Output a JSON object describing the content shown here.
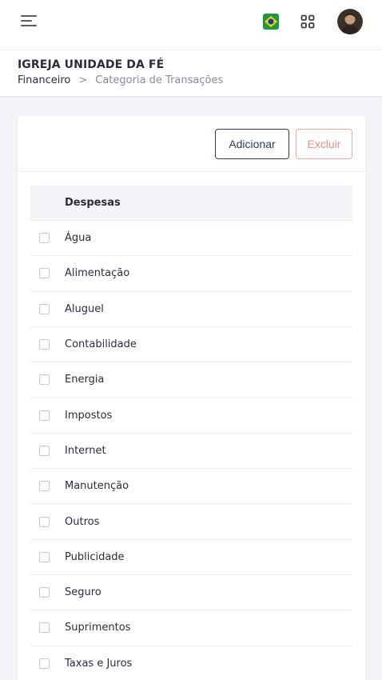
{
  "header": {
    "menu_icon": "hamburger-menu-icon",
    "language_flag": "brazil-flag-icon",
    "apps_icon": "grid-apps-icon",
    "avatar": "user-avatar"
  },
  "page": {
    "org_title": "IGREJA UNIDADE DA FÉ",
    "breadcrumb": [
      "Financeiro",
      "Categoria de Transações"
    ],
    "breadcrumb_separator": ">"
  },
  "toolbar": {
    "add_label": "Adicionar",
    "delete_label": "Excluir"
  },
  "table": {
    "header": "Despesas",
    "rows": [
      "Água",
      "Alimentação",
      "Aluguel",
      "Contabilidade",
      "Energia",
      "Impostos",
      "Internet",
      "Manutenção",
      "Outros",
      "Publicidade",
      "Seguro",
      "Suprimentos",
      "Taxas e Juros"
    ]
  },
  "colors": {
    "primary_outline": "#2d3a5c",
    "danger_outline": "#ef8c80",
    "flag_green": "#1e9a3c",
    "flag_yellow": "#f6d21d",
    "flag_blue": "#1f3a93"
  }
}
